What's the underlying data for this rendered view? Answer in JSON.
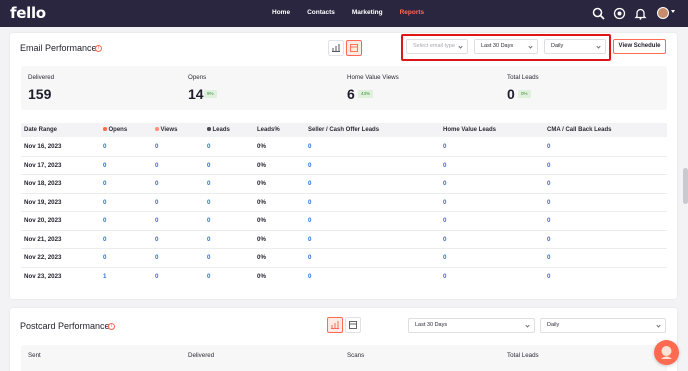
{
  "nav": {
    "logo": "fello",
    "links": [
      {
        "label": "Home",
        "active": false
      },
      {
        "label": "Contacts",
        "active": false
      },
      {
        "label": "Marketing",
        "active": false
      },
      {
        "label": "Reports",
        "active": true
      }
    ],
    "icons": [
      "search-icon",
      "target-icon",
      "bell-icon",
      "avatar",
      "chevron-down-icon"
    ]
  },
  "email": {
    "title": "Email Performance",
    "filters": {
      "email_type_placeholder": "Select email type",
      "range": "Last 30 Days",
      "interval": "Daily"
    },
    "view_schedule": "View Schedule",
    "stats": [
      {
        "label": "Delivered",
        "value": "159",
        "badge": ""
      },
      {
        "label": "Opens",
        "value": "14",
        "badge": "9%"
      },
      {
        "label": "Home Value Views",
        "value": "6",
        "badge": "43%"
      },
      {
        "label": "Total Leads",
        "value": "0",
        "badge": "0%"
      }
    ],
    "table": {
      "headers": [
        "Date Range",
        "Opens",
        "Views",
        "Leads",
        "Leads%",
        "Seller / Cash Offer Leads",
        "Home Value Leads",
        "CMA / Call Back Leads"
      ],
      "rows": [
        [
          "Nov 16, 2023",
          "0",
          "0",
          "0",
          "0%",
          "0",
          "0",
          "0"
        ],
        [
          "Nov 17, 2023",
          "0",
          "0",
          "0",
          "0%",
          "0",
          "0",
          "0"
        ],
        [
          "Nov 18, 2023",
          "0",
          "0",
          "0",
          "0%",
          "0",
          "0",
          "0"
        ],
        [
          "Nov 19, 2023",
          "0",
          "0",
          "0",
          "0%",
          "0",
          "0",
          "0"
        ],
        [
          "Nov 20, 2023",
          "0",
          "0",
          "0",
          "0%",
          "0",
          "0",
          "0"
        ],
        [
          "Nov 21, 2023",
          "0",
          "0",
          "0",
          "0%",
          "0",
          "0",
          "0"
        ],
        [
          "Nov 22, 2023",
          "0",
          "0",
          "0",
          "0%",
          "0",
          "0",
          "0"
        ],
        [
          "Nov 23, 2023",
          "1",
          "0",
          "0",
          "0%",
          "0",
          "0",
          "0"
        ]
      ]
    }
  },
  "postcard": {
    "title": "Postcard Performance",
    "filters": {
      "range": "Last 30 Days",
      "interval": "Daily"
    },
    "stats": [
      {
        "label": "Sent"
      },
      {
        "label": "Delivered"
      },
      {
        "label": "Scans"
      },
      {
        "label": "Total Leads"
      }
    ]
  },
  "colors": {
    "nav_bg": "#2b2640",
    "accent": "#ff6a50",
    "link": "#2f6fd6",
    "highlight": "#e01515",
    "badge_bg": "#dff1dc"
  }
}
